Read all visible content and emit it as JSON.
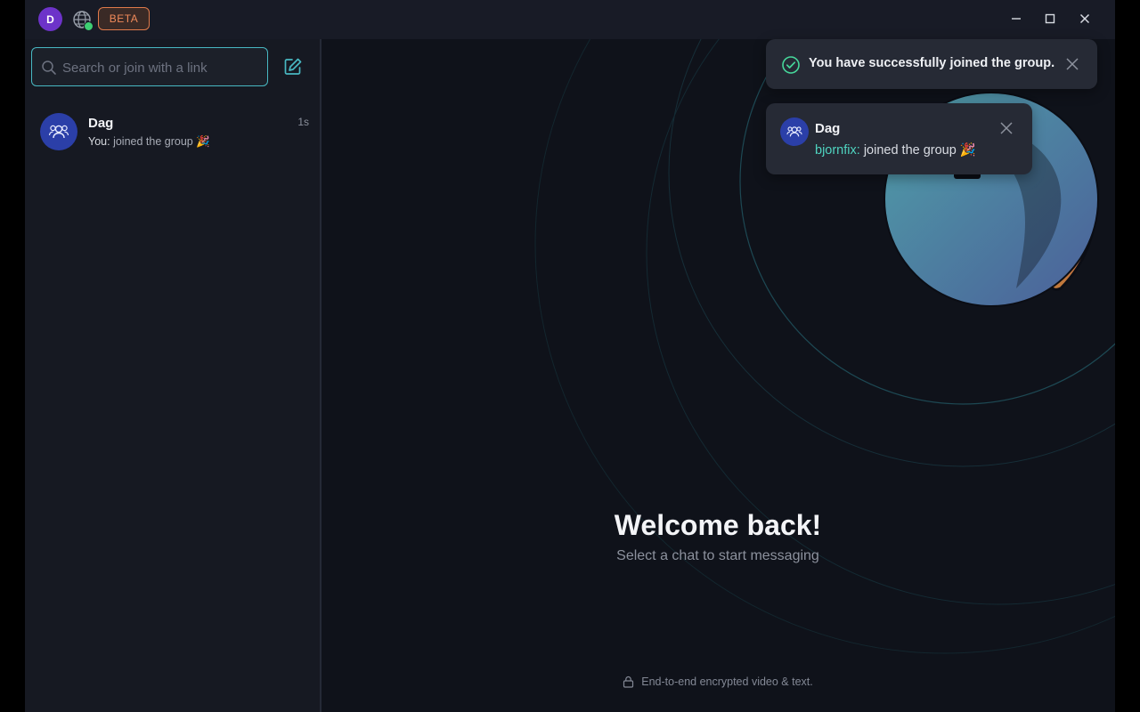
{
  "titlebar": {
    "avatar_initial": "D",
    "beta_label": "BETA",
    "icons": [
      "globe-icon",
      "minimize-icon",
      "maximize-icon",
      "close-icon"
    ],
    "online_color": "#3ecf73"
  },
  "sidebar": {
    "search": {
      "placeholder": "Search or join with a link",
      "value": ""
    },
    "compose_icon": "edit-icon",
    "chats": [
      {
        "name": "Dag",
        "time": "1s",
        "preview_sender": "You:",
        "preview_text": "joined the group 🎉",
        "avatar_icon": "group-icon"
      }
    ]
  },
  "main": {
    "welcome_title": "Welcome back!",
    "welcome_subtitle": "Select a chat to start messaging",
    "footer_text": "End-to-end encrypted video & text."
  },
  "toasts": {
    "success": {
      "message": "You have successfully joined the group.",
      "icon": "check-circle-icon"
    },
    "message": {
      "title": "Dag",
      "sender": "bjornfix:",
      "text": "joined the group 🎉",
      "avatar_icon": "group-icon"
    }
  },
  "colors": {
    "accent": "#48b8c2",
    "beta": "#f08a5a",
    "avatar": "#6d33c9",
    "group_avatar": "#2b3fa8",
    "sender": "#4fd4c0"
  }
}
